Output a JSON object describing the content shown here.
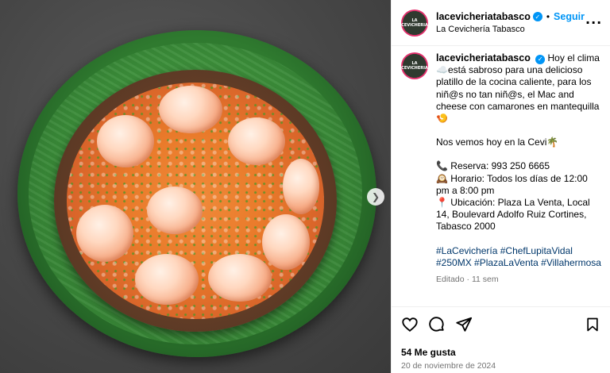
{
  "post": {
    "username": "lacevicheriatabasco",
    "location": "La Cevichería Tabasco",
    "follow_label": "Seguir",
    "avatar_text": "LA CEVICHERIA",
    "caption": {
      "lines": [
        "Hoy el clima ☁️está sabroso para una delicioso platillo de la cocina caliente, para los niñ@s no tan niñ@s, el Mac and cheese con camarones en mantequilla 🍤",
        "Nos vemos hoy en la Cevi🌴",
        "📞 Reserva: 993 250 6665",
        "🕰️ Horario: Todos los días de 12:00 pm a 8:00 pm",
        "📍 Ubicación: Plaza La Venta, Local 14, Boulevard Adolfo Ruiz Cortines, Tabasco 2000"
      ],
      "hashtags": [
        "#LaCevichería",
        "#ChefLupitaVidal",
        "#250MX",
        "#PlazaLaVenta",
        "#Villahermosa"
      ],
      "meta": "Editado · 11 sem"
    },
    "likes": "54 Me gusta",
    "date": "20 de noviembre de 2024"
  },
  "icons": {
    "more": "more-options-icon",
    "like": "heart-icon",
    "comment": "comment-icon",
    "share": "send-icon",
    "save": "bookmark-icon",
    "next": "chevron-right-icon"
  },
  "colors": {
    "accent": "#0095f6",
    "hashtag": "#00376b",
    "muted": "#737373"
  }
}
